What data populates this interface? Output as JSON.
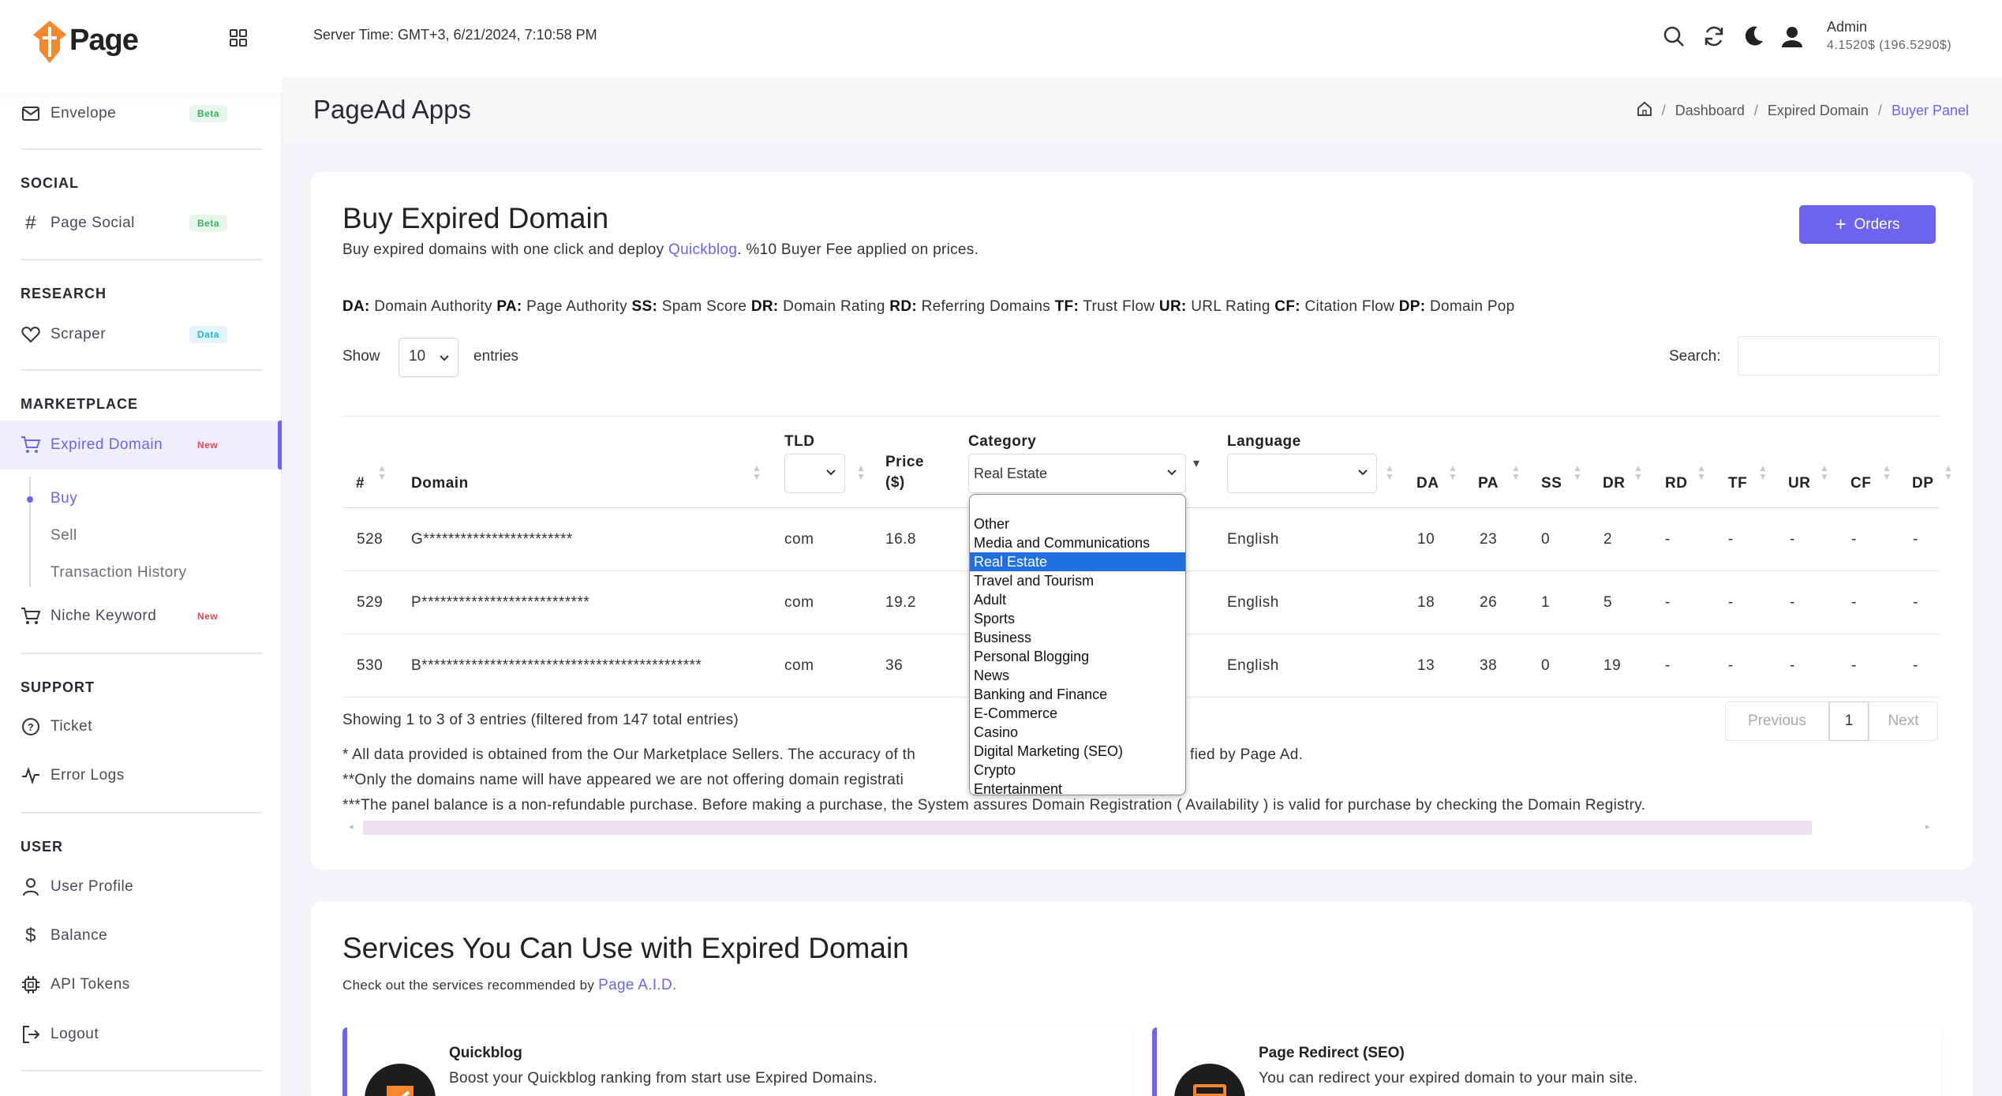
{
  "brand": {
    "name": "Page",
    "logo_color": "#f7872e",
    "accent": "#6c63ef"
  },
  "sidebar": {
    "items_top": [
      {
        "label": "Envelope",
        "badge": "Beta"
      }
    ],
    "sections": [
      {
        "title": "SOCIAL",
        "items": [
          {
            "label": "Page Social",
            "badge": "Beta"
          }
        ]
      },
      {
        "title": "RESEARCH",
        "items": [
          {
            "label": "Scraper",
            "badge": "Data"
          }
        ]
      },
      {
        "title": "MARKETPLACE",
        "items": [
          {
            "label": "Expired Domain",
            "badge": "New"
          },
          {
            "label": "Niche Keyword",
            "badge": "New"
          }
        ]
      },
      {
        "title": "SUPPORT",
        "items": [
          {
            "label": "Ticket"
          },
          {
            "label": "Error Logs"
          }
        ]
      },
      {
        "title": "USER",
        "items": [
          {
            "label": "User Profile"
          },
          {
            "label": "Balance"
          },
          {
            "label": "API Tokens"
          },
          {
            "label": "Logout"
          }
        ]
      }
    ],
    "subitems": [
      {
        "label": "Buy"
      },
      {
        "label": "Sell"
      },
      {
        "label": "Transaction History"
      }
    ]
  },
  "topbar": {
    "server_time": "Server Time: GMT+3, 6/21/2024, 7:10:58 PM",
    "user_name": "Admin",
    "balance": "4.1520$ (196.5290$)"
  },
  "pagehead": {
    "title": "PageAd Apps",
    "breadcrumb": [
      "Dashboard",
      "Expired Domain",
      "Buyer Panel"
    ]
  },
  "main": {
    "title": "Buy Expired Domain",
    "subtitle_pre": "Buy expired domains with one click and deploy ",
    "subtitle_link": "Quickblog",
    "subtitle_post": ". %10 Buyer Fee applied on prices.",
    "orders_label": "Orders",
    "legend": [
      {
        "abbr": "DA:",
        "text": "Domain Authority"
      },
      {
        "abbr": "PA:",
        "text": "Page Authority"
      },
      {
        "abbr": "SS:",
        "text": "Spam Score"
      },
      {
        "abbr": "DR:",
        "text": "Domain Rating"
      },
      {
        "abbr": "RD:",
        "text": "Referring Domains"
      },
      {
        "abbr": "TF:",
        "text": "Trust Flow"
      },
      {
        "abbr": "UR:",
        "text": "URL Rating"
      },
      {
        "abbr": "CF:",
        "text": "Citation Flow"
      },
      {
        "abbr": "DP:",
        "text": "Domain Pop"
      }
    ],
    "show_label": "Show",
    "show_value": "10",
    "entries_label": "entries",
    "search_label": "Search:",
    "columns": [
      "#",
      "Domain",
      "TLD",
      "Price ($)",
      "Category",
      "Language",
      "DA",
      "PA",
      "SS",
      "DR",
      "RD",
      "TF",
      "UR",
      "CF",
      "DP"
    ],
    "category_selected": "Real Estate",
    "rows": [
      [
        "528",
        "G************************",
        "com",
        "16.8",
        "",
        "English",
        "10",
        "23",
        "0",
        "2",
        "-",
        "-",
        "-",
        "-",
        "-"
      ],
      [
        "529",
        "P***************************",
        "com",
        "19.2",
        "",
        "English",
        "18",
        "26",
        "1",
        "5",
        "-",
        "-",
        "-",
        "-",
        "-"
      ],
      [
        "530",
        "B*********************************************",
        "com",
        "36",
        "",
        "English",
        "13",
        "38",
        "0",
        "19",
        "-",
        "-",
        "-",
        "-",
        "-"
      ]
    ],
    "showing": "Showing 1 to 3 of 3 entries (filtered from 147 total entries)",
    "pager": {
      "prev": "Previous",
      "page": "1",
      "next": "Next"
    },
    "notes": [
      "* All data provided is obtained from the Our Marketplace Sellers. The accuracy of th",
      "fied by Page Ad.",
      "**Only the domains name will have appeared we are not offering domain registrati",
      "***The panel balance is a non-refundable purchase. Before making a purchase, the System assures Domain Registration ( Availability ) is valid for purchase by checking the Domain Registry."
    ],
    "category_options": [
      "Other",
      "Media and Communications",
      "Real Estate",
      "Travel and Tourism",
      "Adult",
      "Sports",
      "Business",
      "Personal Blogging",
      "News",
      "Banking and Finance",
      "E-Commerce",
      "Casino",
      "Digital Marketing (SEO)",
      "Crypto",
      "Entertainment"
    ]
  },
  "services": {
    "title": "Services You Can Use with Expired Domain",
    "subtitle_pre": "Check out the services recommended by ",
    "subtitle_link": "Page A.I.D.",
    "cards": [
      {
        "title": "Quickblog",
        "desc": "Boost your Quickblog ranking from start use Expired Domains."
      },
      {
        "title": "Page Redirect (SEO)",
        "desc": "You can redirect your expired domain to your main site."
      }
    ]
  }
}
